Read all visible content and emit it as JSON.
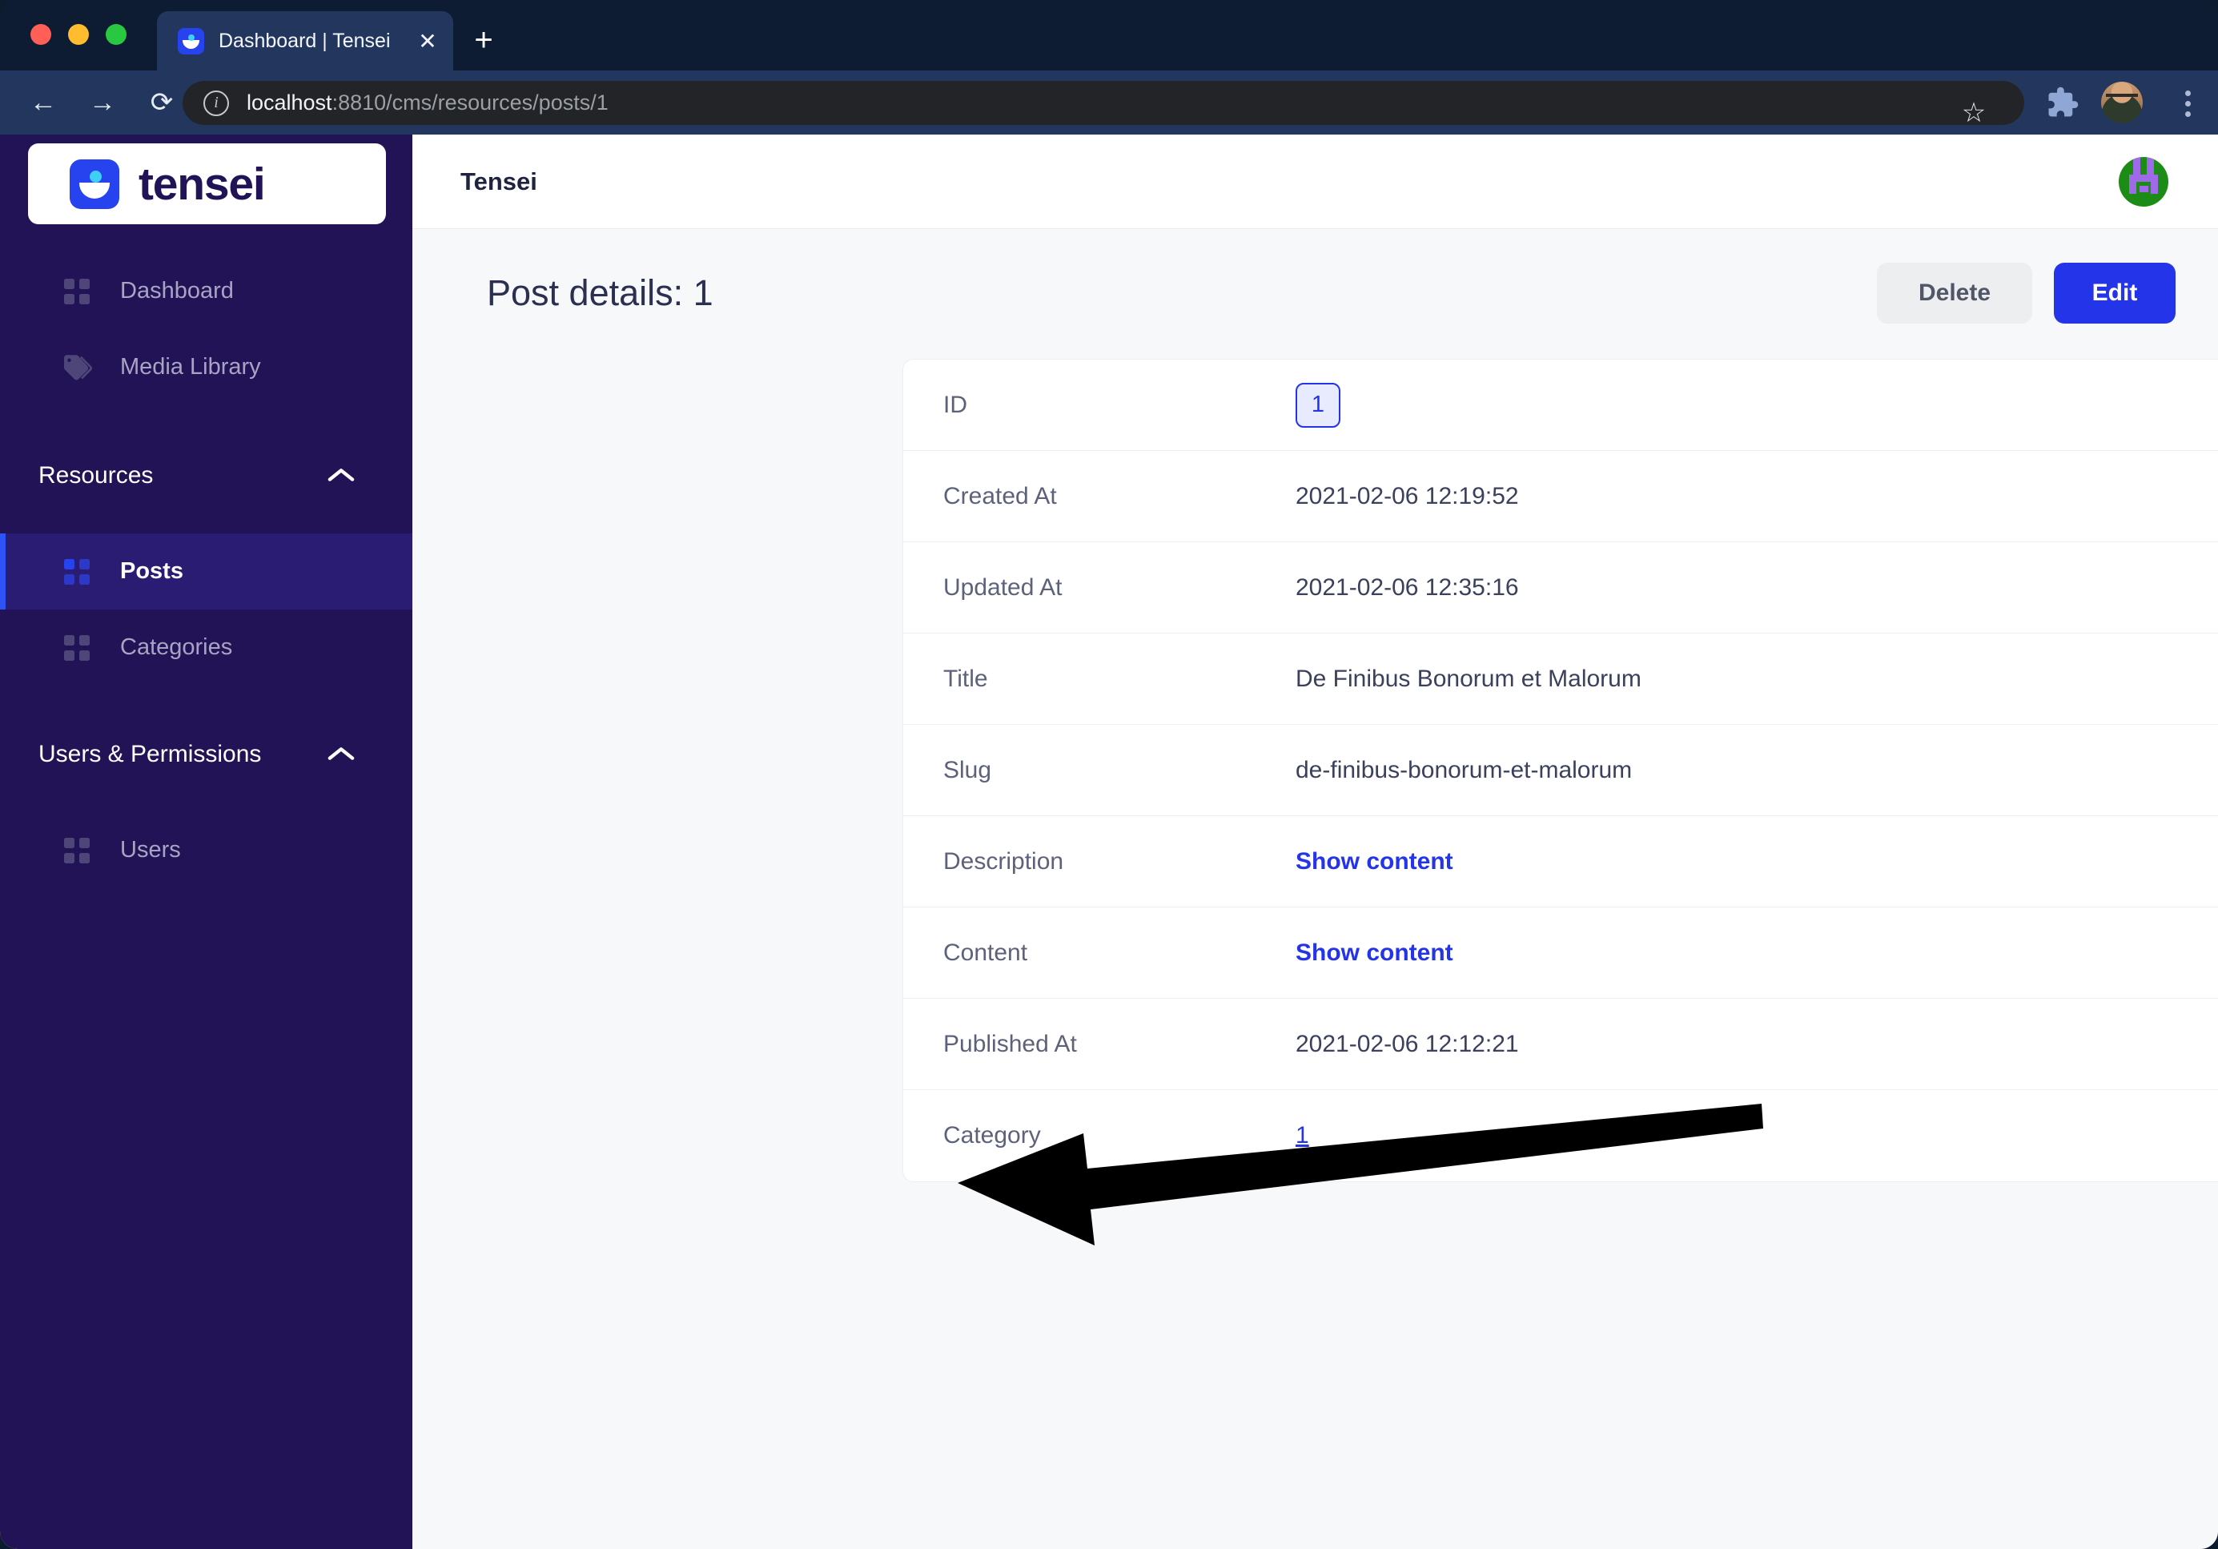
{
  "browser": {
    "tab_title": "Dashboard | Tensei",
    "tab_favicon": "tensei-logo-icon",
    "close_label": "✕",
    "newtab_label": "+",
    "back_icon": "←",
    "forward_icon": "→",
    "reload_icon": "⟳",
    "info_icon": "i",
    "url_host": "localhost",
    "url_path": ":8810/cms/resources/posts/1",
    "star_icon": "☆",
    "extensions_icon": "puzzle-icon",
    "profile_icon": "profile-photo",
    "menu_icon": "kebab-menu-icon"
  },
  "sidebar": {
    "brand": "tensei",
    "items": [
      {
        "label": "Dashboard",
        "icon": "grid-icon",
        "active": false
      },
      {
        "label": "Media Library",
        "icon": "tag-icon",
        "active": false
      }
    ],
    "sections": [
      {
        "title": "Resources",
        "chevron": "▲",
        "items": [
          {
            "label": "Posts",
            "icon": "grid-icon",
            "active": true
          },
          {
            "label": "Categories",
            "icon": "grid-icon",
            "active": false
          }
        ]
      },
      {
        "title": "Users & Permissions",
        "chevron": "▲",
        "items": [
          {
            "label": "Users",
            "icon": "grid-icon",
            "active": false
          }
        ]
      }
    ]
  },
  "topbar": {
    "title": "Tensei",
    "avatar": "user-identicon-avatar"
  },
  "page": {
    "title": "Post details: 1",
    "delete_label": "Delete",
    "edit_label": "Edit"
  },
  "detail_rows": [
    {
      "key": "ID",
      "value": "1",
      "type": "badge"
    },
    {
      "key": "Created At",
      "value": "2021-02-06 12:19:52",
      "type": "text"
    },
    {
      "key": "Updated At",
      "value": "2021-02-06 12:35:16",
      "type": "text"
    },
    {
      "key": "Title",
      "value": "De Finibus Bonorum et Malorum",
      "type": "text"
    },
    {
      "key": "Slug",
      "value": "de-finibus-bonorum-et-malorum",
      "type": "text"
    },
    {
      "key": "Description",
      "value": "Show content",
      "type": "link"
    },
    {
      "key": "Content",
      "value": "Show content",
      "type": "link"
    },
    {
      "key": "Published At",
      "value": "2021-02-06 12:12:21",
      "type": "text"
    },
    {
      "key": "Category",
      "value": "1",
      "type": "link-thin"
    }
  ],
  "annotation": {
    "type": "arrow",
    "points_to": "category-value-link",
    "color": "#000000"
  },
  "colors": {
    "sidebar_bg": "#211355",
    "sidebar_active_bg": "#2a1b73",
    "accent_blue": "#2434e8",
    "active_bar": "#2f52f7",
    "page_bg": "#f7f8fa",
    "card_bg": "#ffffff",
    "browser_chrome": "#23375e",
    "tabstrip": "#0e1c33"
  }
}
